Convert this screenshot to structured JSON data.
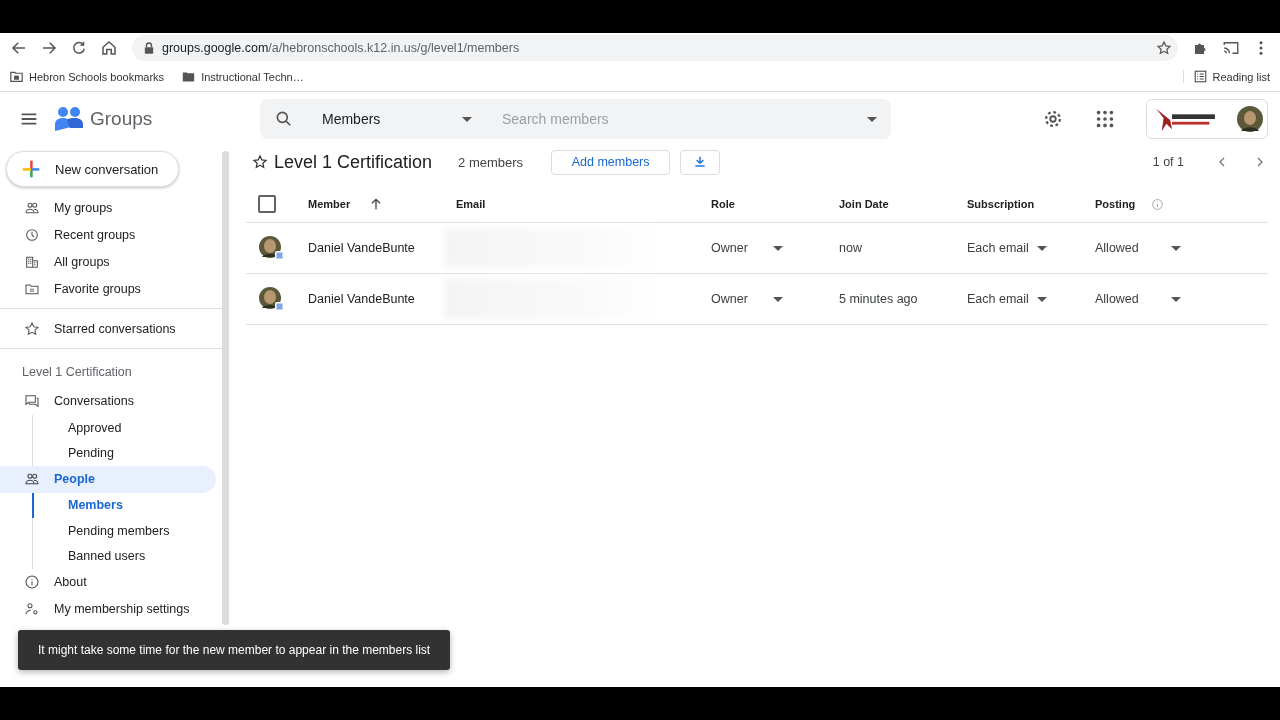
{
  "browser": {
    "url_host": "groups.google.com",
    "url_path": "/a/hebronschools.k12.in.us/g/level1/members",
    "bookmarks": [
      {
        "label": "Hebron Schools bookmarks",
        "kind": "apps"
      },
      {
        "label": "Instructional Techn…",
        "kind": "folder"
      }
    ],
    "reading_list": "Reading list"
  },
  "app": {
    "name": "Groups"
  },
  "search": {
    "scope": "Members",
    "placeholder": "Search members"
  },
  "new_conversation": "New conversation",
  "nav_top": [
    {
      "label": "My groups",
      "kind": "people"
    },
    {
      "label": "Recent groups",
      "kind": "clock"
    },
    {
      "label": "All groups",
      "kind": "building"
    },
    {
      "label": "Favorite groups",
      "kind": "folder"
    }
  ],
  "nav_starred": {
    "label": "Starred conversations",
    "kind": "star"
  },
  "group_nav": {
    "heading": "Level 1 Certification",
    "items": [
      {
        "label": "Conversations",
        "kind": "chat",
        "selected": false,
        "children": [
          {
            "label": "Approved",
            "selected": false
          },
          {
            "label": "Pending",
            "selected": false
          }
        ]
      },
      {
        "label": "People",
        "kind": "people",
        "selected": true,
        "children": [
          {
            "label": "Members",
            "selected": true
          },
          {
            "label": "Pending members",
            "selected": false
          },
          {
            "label": "Banned users",
            "selected": false
          }
        ]
      },
      {
        "label": "About",
        "kind": "info",
        "selected": false
      },
      {
        "label": "My membership settings",
        "kind": "usergear",
        "selected": false
      }
    ]
  },
  "group": {
    "title": "Level 1 Certification",
    "starred": false,
    "member_count": "2 members",
    "add_button": "Add members",
    "pagination": "1 of 1"
  },
  "table": {
    "all_checked": false,
    "columns": [
      "Member",
      "Email",
      "Role",
      "Join Date",
      "Subscription",
      "Posting"
    ],
    "rows": [
      {
        "member": "Daniel VandeBunte",
        "role": "Owner",
        "join_date": "now",
        "subscription": "Each email",
        "posting": "Allowed"
      },
      {
        "member": "Daniel VandeBunte",
        "role": "Owner",
        "join_date": "5 minutes ago",
        "subscription": "Each email",
        "posting": "Allowed"
      }
    ]
  },
  "toast": "It might take some time for the new member to appear in the members list"
}
